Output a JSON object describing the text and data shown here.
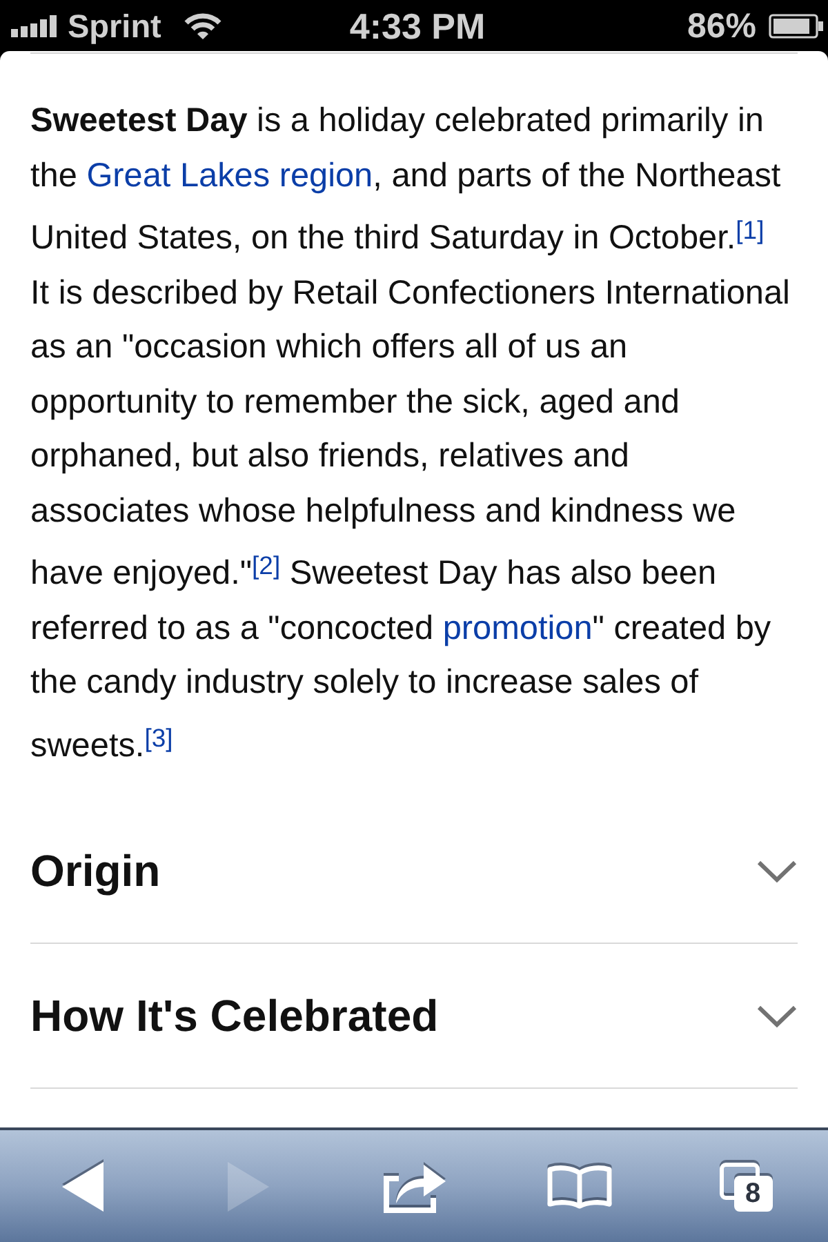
{
  "status_bar": {
    "carrier": "Sprint",
    "time": "4:33 PM",
    "battery": "86%"
  },
  "article": {
    "intro": [
      {
        "kind": "text",
        "text": "**Sweetest Day** is a holiday celebrated primarily in the "
      },
      {
        "kind": "link",
        "text": "Great Lakes region"
      },
      {
        "kind": "text",
        "text": ", and parts of the Northeast United States, on the third Saturday in October."
      },
      {
        "kind": "ref",
        "text": "[1]"
      },
      {
        "kind": "text",
        "text": " It is described by Retail Confectioners International as an \"occasion which offers all of us an opportunity to remember the sick, aged and orphaned, but also friends, relatives and associates whose helpfulness and kindness we have enjoyed.\""
      },
      {
        "kind": "ref",
        "text": "[2]"
      },
      {
        "kind": "text",
        "text": " Sweetest Day has also been referred to as a \"concocted "
      },
      {
        "kind": "link",
        "text": "promotion"
      },
      {
        "kind": "text",
        "text": "\" created by the candy industry solely to increase sales of sweets."
      },
      {
        "kind": "ref",
        "text": "[3]"
      }
    ]
  },
  "sections": [
    {
      "title": "Origin",
      "expanded": false
    },
    {
      "title": "How It's Celebrated",
      "expanded": false
    }
  ],
  "toolbar": [
    {
      "kind": "back",
      "disabled": false
    },
    {
      "kind": "forward",
      "disabled": true
    },
    {
      "kind": "share"
    },
    {
      "kind": "bookmarks"
    },
    {
      "kind": "tabs",
      "count": "8"
    }
  ]
}
